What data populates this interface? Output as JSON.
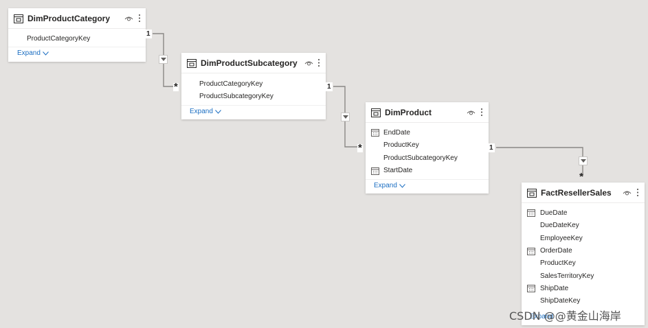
{
  "tables": {
    "dim_product_category": {
      "title": "DimProductCategory",
      "fields": [
        "ProductCategoryKey"
      ],
      "expand_label": "Expand"
    },
    "dim_product_subcategory": {
      "title": "DimProductSubcategory",
      "fields": [
        "ProductCategoryKey",
        "ProductSubcategoryKey"
      ],
      "expand_label": "Expand"
    },
    "dim_product": {
      "title": "DimProduct",
      "fields": [
        "EndDate",
        "ProductKey",
        "ProductSubcategoryKey",
        "StartDate"
      ],
      "date_fields": [
        "EndDate",
        "StartDate"
      ],
      "expand_label": "Expand"
    },
    "fact_reseller_sales": {
      "title": "FactResellerSales",
      "fields": [
        "DueDate",
        "DueDateKey",
        "EmployeeKey",
        "OrderDate",
        "ProductKey",
        "SalesTerritoryKey",
        "ShipDate",
        "ShipDateKey"
      ],
      "date_fields": [
        "DueDate",
        "OrderDate",
        "ShipDate"
      ],
      "expand_label": "Expand"
    }
  },
  "relationships": [
    {
      "from": "DimProductCategory",
      "to": "DimProductSubcategory",
      "one_label": "1",
      "many_label": "*"
    },
    {
      "from": "DimProductSubcategory",
      "to": "DimProduct",
      "one_label": "1",
      "many_label": "*"
    },
    {
      "from": "DimProduct",
      "to": "FactResellerSales",
      "one_label": "1",
      "many_label": "*"
    }
  ],
  "watermark": "CSDN @@黄金山海岸",
  "icons": {
    "table": "table-icon",
    "visibility": "eye-icon",
    "more": "more-options-icon",
    "date": "calendar-icon",
    "expand": "chevron-down-icon",
    "filter_direction": "caret-down-icon"
  },
  "colors": {
    "canvas": "#e4e2e0",
    "card": "#ffffff",
    "link": "#1b6ec2",
    "line": "#8a8886",
    "text": "#252423"
  }
}
